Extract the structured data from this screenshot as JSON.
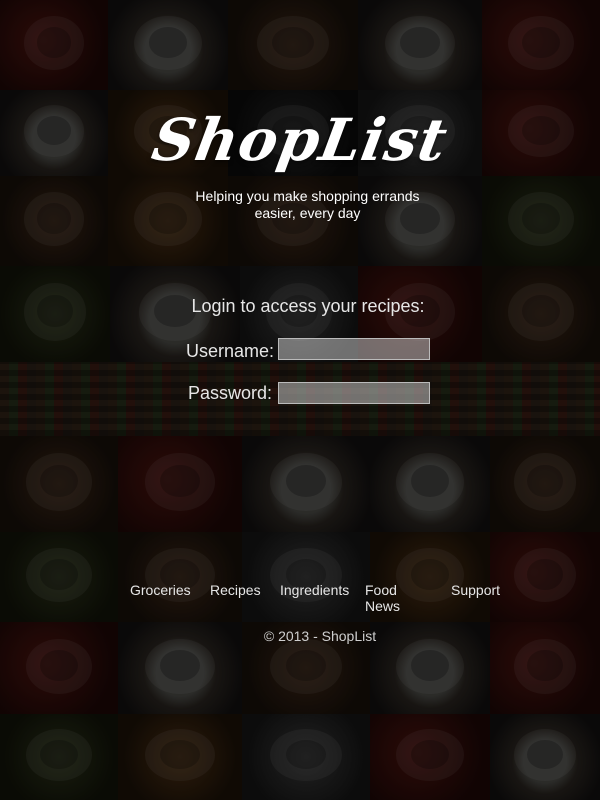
{
  "app": {
    "logo_text": "ShopList",
    "tagline": "Helping you make shopping errands easier, every day"
  },
  "login": {
    "heading": "Login to access your recipes:",
    "username_label": "Username:",
    "username_value": "",
    "password_label": "Password:",
    "password_value": ""
  },
  "footer": {
    "nav": [
      "Groceries",
      "Recipes",
      "Ingredients",
      "Food News",
      "Support"
    ],
    "copyright": "© 2013 - ShopList"
  }
}
